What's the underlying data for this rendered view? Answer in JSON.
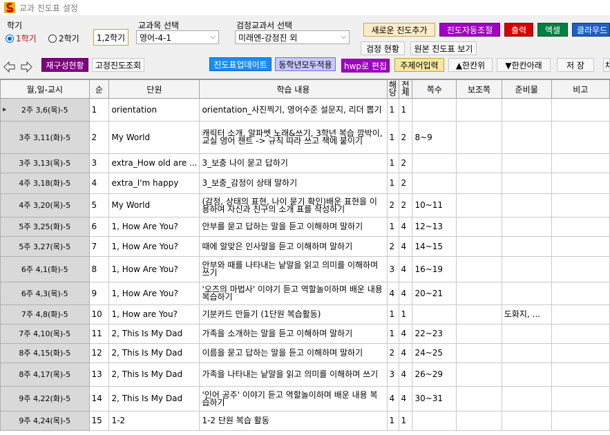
{
  "window": {
    "title": "교과 진도표 설정"
  },
  "semester": {
    "label": "학기",
    "opt1": "1학기",
    "opt2": "2학기",
    "both_button": "1,2학기"
  },
  "subject": {
    "label": "교과목 선택",
    "value": "영어-4-1"
  },
  "textbook": {
    "label": "검정교과서 선택",
    "value": "미래엔-강정진 외"
  },
  "buttons": {
    "new_progress": "새로운 진도추가",
    "auto_adjust": "진도자동조절",
    "print": "출력",
    "excel": "엑셀",
    "cloud": "클라우드",
    "textbook_status": "검정 현황",
    "original_view": "원본 진도표 보기",
    "reorg_status": "재구성현황",
    "fixed_lookup": "고정진도조회",
    "update": "진도표업데이트",
    "apply_same_grade": "동학년모두적용",
    "hwp_edit": "hwp로 편집",
    "theme_input": "주제어입력",
    "up_one": "▲한칸위",
    "down_one": "▼한칸아래",
    "save": "저 장",
    "extra": "채"
  },
  "colors": {
    "new_progress_bg": "#ffebc8",
    "auto_adjust_bg": "#a000c0",
    "print_bg": "#d40000",
    "excel_bg": "#008040",
    "cloud_bg": "#2060c0",
    "reorg_bg": "#800080",
    "update_bg": "#1e8cf0",
    "apply_bg": "#c8c8ff",
    "hwp_bg": "#a000c0",
    "theme_bg": "#f5e6a0"
  },
  "table": {
    "headers": [
      "월,일-교시",
      "순",
      "단원",
      "학습 내용",
      "해당",
      "전체",
      "쪽수",
      "보조쪽",
      "준비물",
      "비고"
    ],
    "rows": [
      {
        "date": "2주 3,6(목)-5",
        "seq": "1",
        "unit": "orientation",
        "content": "orientation_사진찍기, 영어수준 설문지, 리더 뽑기",
        "cur": "1",
        "total": "1",
        "pages": "",
        "sub": "",
        "prep": "",
        "note": ""
      },
      {
        "date": "3주 3,11(화)-5",
        "seq": "2",
        "unit": "My World",
        "content": "캐릭터 소개, 알파벳 노래&쓰기, 3학년 복습 깜박이, 교실 영어 챈트 -> 규칙 따라 쓰고 책에 붙이기",
        "cur": "1",
        "total": "2",
        "pages": "8~9",
        "sub": "",
        "prep": "",
        "note": ""
      },
      {
        "date": "3주 3,13(목)-5",
        "seq": "3",
        "unit": "extra_How old are ...",
        "content": "3_보충 나이 묻고 답하기",
        "cur": "1",
        "total": "2",
        "pages": "",
        "sub": "",
        "prep": "",
        "note": ""
      },
      {
        "date": "4주 3,18(화)-5",
        "seq": "4",
        "unit": "extra_I'm happy",
        "content": "3_보충_감정이 상태 말하기",
        "cur": "1",
        "total": "2",
        "pages": "",
        "sub": "",
        "prep": "",
        "note": ""
      },
      {
        "date": "4주 3,20(목)-5",
        "seq": "5",
        "unit": "My World",
        "content": "(감정, 상태의 표현, 나이 묻기 확인)배운 표현을 이용하여 자신과 친구의 소개 표를 작성하기",
        "cur": "2",
        "total": "2",
        "pages": "10~11",
        "sub": "",
        "prep": "",
        "note": ""
      },
      {
        "date": "5주 3,25(화)-5",
        "seq": "6",
        "unit": "1, How Are You?",
        "content": "안부를 묻고 답하는 말을 듣고 이해하며 말하기",
        "cur": "1",
        "total": "4",
        "pages": "12~13",
        "sub": "",
        "prep": "",
        "note": ""
      },
      {
        "date": "5주 3,27(목)-5",
        "seq": "7",
        "unit": "1, How Are You?",
        "content": " 때에 알맞은 인사말을 듣고 이해하며 말하기",
        "cur": "2",
        "total": "4",
        "pages": "14~15",
        "sub": "",
        "prep": "",
        "note": ""
      },
      {
        "date": "6주 4,1(화)-5",
        "seq": "8",
        "unit": "1, How Are You?",
        "content": "안부와 때를 나타내는 낱말을 읽고 의미를 이해하며 쓰기",
        "cur": "3",
        "total": "4",
        "pages": "16~19",
        "sub": "",
        "prep": "",
        "note": ""
      },
      {
        "date": "6주 4,3(목)-5",
        "seq": "9",
        "unit": "1, How Are You?",
        "content": "'오즈의 마법사' 이야기 듣고 역할놀이하며 배운 내용 복습하기",
        "cur": "4",
        "total": "4",
        "pages": "20~21",
        "sub": "",
        "prep": "",
        "note": ""
      },
      {
        "date": "7주 4,8(화)-5",
        "seq": "10",
        "unit": "1, How are You?",
        "content": "기분카드 만들기 (1단원 복습활동)",
        "cur": "1",
        "total": "1",
        "pages": "",
        "sub": "",
        "prep": "도화지, ...",
        "note": ""
      },
      {
        "date": "7주 4,10(목)-5",
        "seq": "11",
        "unit": "2, This Is My Dad",
        "content": "가족을 소개하는 말을 듣고 이해하며 말하기",
        "cur": "1",
        "total": "4",
        "pages": "22~23",
        "sub": "",
        "prep": "",
        "note": ""
      },
      {
        "date": "8주 4,15(화)-5",
        "seq": "12",
        "unit": "2, This Is My Dad",
        "content": "이름을 묻고 답하는 말을 듣고 이해하며 말하기",
        "cur": "2",
        "total": "4",
        "pages": "24~25",
        "sub": "",
        "prep": "",
        "note": ""
      },
      {
        "date": "8주 4,17(목)-5",
        "seq": "13",
        "unit": "2, This Is My Dad",
        "content": "가족을 나타내는 낱말을 읽고 의미를 이해하며 쓰기",
        "cur": "3",
        "total": "4",
        "pages": "26~29",
        "sub": "",
        "prep": "",
        "note": ""
      },
      {
        "date": "9주 4,22(화)-5",
        "seq": "14",
        "unit": "2, This Is My Dad",
        "content": "'인어 공주' 이야기 듣고 역할놀이하며 배운 내용 복습하기",
        "cur": "4",
        "total": "4",
        "pages": "30~31",
        "sub": "",
        "prep": "",
        "note": ""
      },
      {
        "date": "9주 4,24(목)-5",
        "seq": "15",
        "unit": "1-2",
        "content": "1-2 단원 복습 활동",
        "cur": "1",
        "total": "1",
        "pages": "",
        "sub": "",
        "prep": "",
        "note": ""
      }
    ]
  }
}
